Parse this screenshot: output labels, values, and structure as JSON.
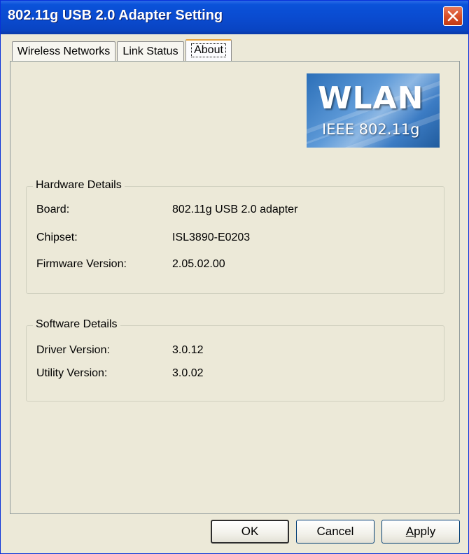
{
  "window": {
    "title": "802.11g USB 2.0 Adapter Setting"
  },
  "tabs": [
    {
      "label": "Wireless Networks",
      "active": false
    },
    {
      "label": "Link Status",
      "active": false
    },
    {
      "label": "About",
      "active": true
    }
  ],
  "logo": {
    "main": "WLAN",
    "sub": "IEEE 802.11g"
  },
  "hardware": {
    "title": "Hardware Details",
    "rows": [
      {
        "label": "Board:",
        "value": "802.11g USB 2.0 adapter"
      },
      {
        "label": "Chipset:",
        "value": "ISL3890-E0203"
      },
      {
        "label": "Firmware Version:",
        "value": "2.05.02.00"
      }
    ]
  },
  "software": {
    "title": "Software Details",
    "rows": [
      {
        "label": "Driver Version:",
        "value": "3.0.12"
      },
      {
        "label": "Utility Version:",
        "value": "3.0.02"
      }
    ]
  },
  "buttons": {
    "ok": "OK",
    "cancel": "Cancel",
    "apply_first": "A",
    "apply_rest": "pply"
  },
  "icons": {
    "close": "close-icon"
  },
  "colors": {
    "titlebar": "#0a4bd0",
    "close": "#d8502a",
    "face": "#ece9d8",
    "tab_highlight": "#e8a33c"
  }
}
